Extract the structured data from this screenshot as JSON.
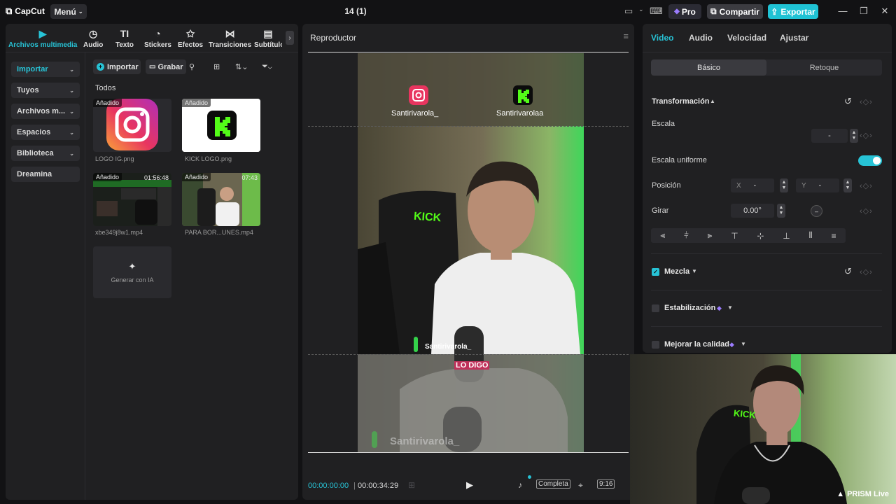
{
  "titlebar": {
    "app_name": "CapCut",
    "menu_label": "Menú",
    "project_title": "14 (1)",
    "pro_label": "Pro",
    "share_label": "Compartir",
    "export_label": "Exportar",
    "accent": "#1fc2d4"
  },
  "media_toolbar": {
    "tabs": [
      {
        "label": "Archivos multimedia",
        "icon": "media-icon",
        "active": true
      },
      {
        "label": "Audio",
        "icon": "audio-icon"
      },
      {
        "label": "Texto",
        "icon": "text-icon"
      },
      {
        "label": "Stickers",
        "icon": "sticker-icon"
      },
      {
        "label": "Efectos",
        "icon": "effects-icon"
      },
      {
        "label": "Transiciones",
        "icon": "transition-icon"
      },
      {
        "label": "Subtítulos",
        "icon": "subtitles-icon"
      }
    ]
  },
  "media_sidebar": {
    "items": [
      {
        "label": "Importar",
        "active": true
      },
      {
        "label": "Tuyos"
      },
      {
        "label": "Archivos m..."
      },
      {
        "label": "Espacios"
      },
      {
        "label": "Biblioteca"
      },
      {
        "label": "Dreamina"
      }
    ]
  },
  "media_actions": {
    "import_label": "Importar",
    "record_label": "Grabar",
    "section_label": "Todos"
  },
  "media_items": [
    {
      "name": "LOGO IG.png",
      "badge": "Añadido"
    },
    {
      "name": "KICK LOGO.png",
      "badge": "Añadido"
    },
    {
      "name": "xbe349j8w1.mp4",
      "badge": "Añadido",
      "duration": "01:56:48"
    },
    {
      "name": "PARA BOR...UNES.mp4",
      "badge": "Añadido",
      "duration": "07:43"
    }
  ],
  "generate_ai_label": "Generar con IA",
  "player": {
    "title": "Reproductor",
    "current_time": "00:00:00:00",
    "total_time": "00:00:34:29",
    "full_label": "Completa",
    "ratio_label": "9:16",
    "frame": {
      "ig_handle": "Santirivarola_",
      "kick_handle": "Santirivarolaa",
      "chair_text": "KICK",
      "overlay_name": "Santirivarola_",
      "caption": "LO DIGO",
      "bottom_name": "Santirivarola_"
    }
  },
  "properties": {
    "tabs": [
      {
        "label": "Video",
        "active": true
      },
      {
        "label": "Audio"
      },
      {
        "label": "Velocidad"
      },
      {
        "label": "Ajustar"
      }
    ],
    "subtabs": {
      "basic": "Básico",
      "retouch": "Retoque"
    },
    "transform_label": "Transformación",
    "scale_label": "Escala",
    "scale_value": "-",
    "uniform_scale_label": "Escala uniforme",
    "uniform_scale_on": true,
    "position_label": "Posición",
    "pos_x_label": "X",
    "pos_x_value": "-",
    "pos_y_label": "Y",
    "pos_y_value": "-",
    "rotate_label": "Girar",
    "rotate_value": "0.00°",
    "blend_label": "Mezcla",
    "blend_checked": true,
    "stabilization_label": "Estabilización",
    "quality_label": "Mejorar la calidad"
  },
  "webcam": {
    "watermark": "PRISM Live",
    "shirt_text": "KICK"
  }
}
